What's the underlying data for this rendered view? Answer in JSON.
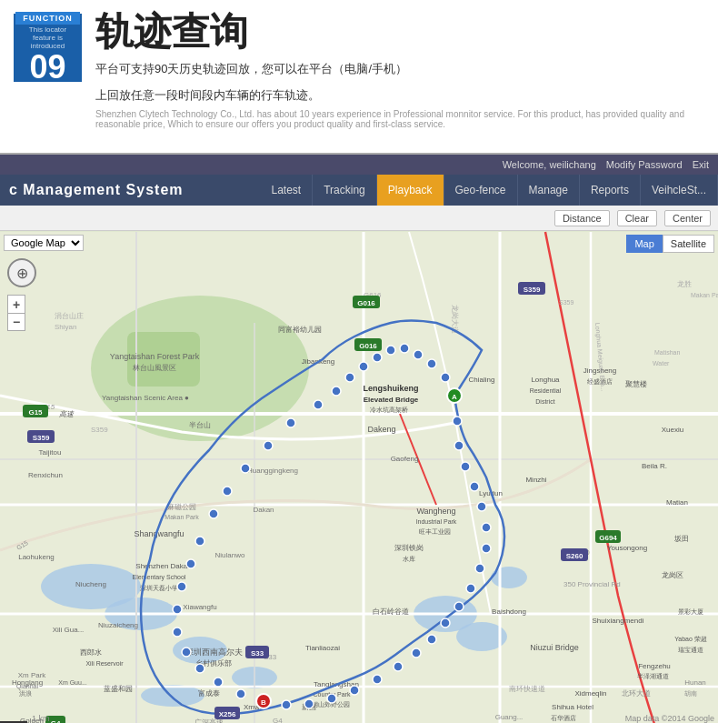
{
  "banner": {
    "function_label": "FUNCTION",
    "function_intro": "This locator feature is introduced",
    "function_number": "09",
    "title_cn": "轨迹查询",
    "desc_line1": "平台可支持90天历史轨迹回放，您可以在平台（电脑/手机）",
    "desc_line2": "上回放任意一段时间段内车辆的行车轨迹。",
    "sub_text": "Shenzhen Clytech Technology Co., Ltd. has about 10 years experience in Professional monnitor service. For this product, has provided quality and reasonable price, Which to ensure our offers you product quality and first-class service."
  },
  "app": {
    "welcome_text": "Welcome, weilichang",
    "modify_password": "Modify Password",
    "exit": "Exit",
    "nav_title": "c Management System",
    "tabs": [
      {
        "id": "latest",
        "label": "Latest",
        "active": false
      },
      {
        "id": "tracking",
        "label": "Tracking",
        "active": false
      },
      {
        "id": "playback",
        "label": "Playback",
        "active": true
      },
      {
        "id": "geo-fence",
        "label": "Geo-fence",
        "active": false
      },
      {
        "id": "manage",
        "label": "Manage",
        "active": false
      },
      {
        "id": "reports",
        "label": "Reports",
        "active": false
      },
      {
        "id": "vehicle-status",
        "label": "VeihcleSt...",
        "active": false
      }
    ],
    "toolbar": {
      "distance": "Distance",
      "clear": "Clear",
      "center": "Center"
    },
    "map_selector": "Google Map",
    "map_type_btns": [
      "Map",
      "Satellite"
    ],
    "map_type_active": "Map",
    "zoom_plus": "+",
    "zoom_minus": "-"
  }
}
